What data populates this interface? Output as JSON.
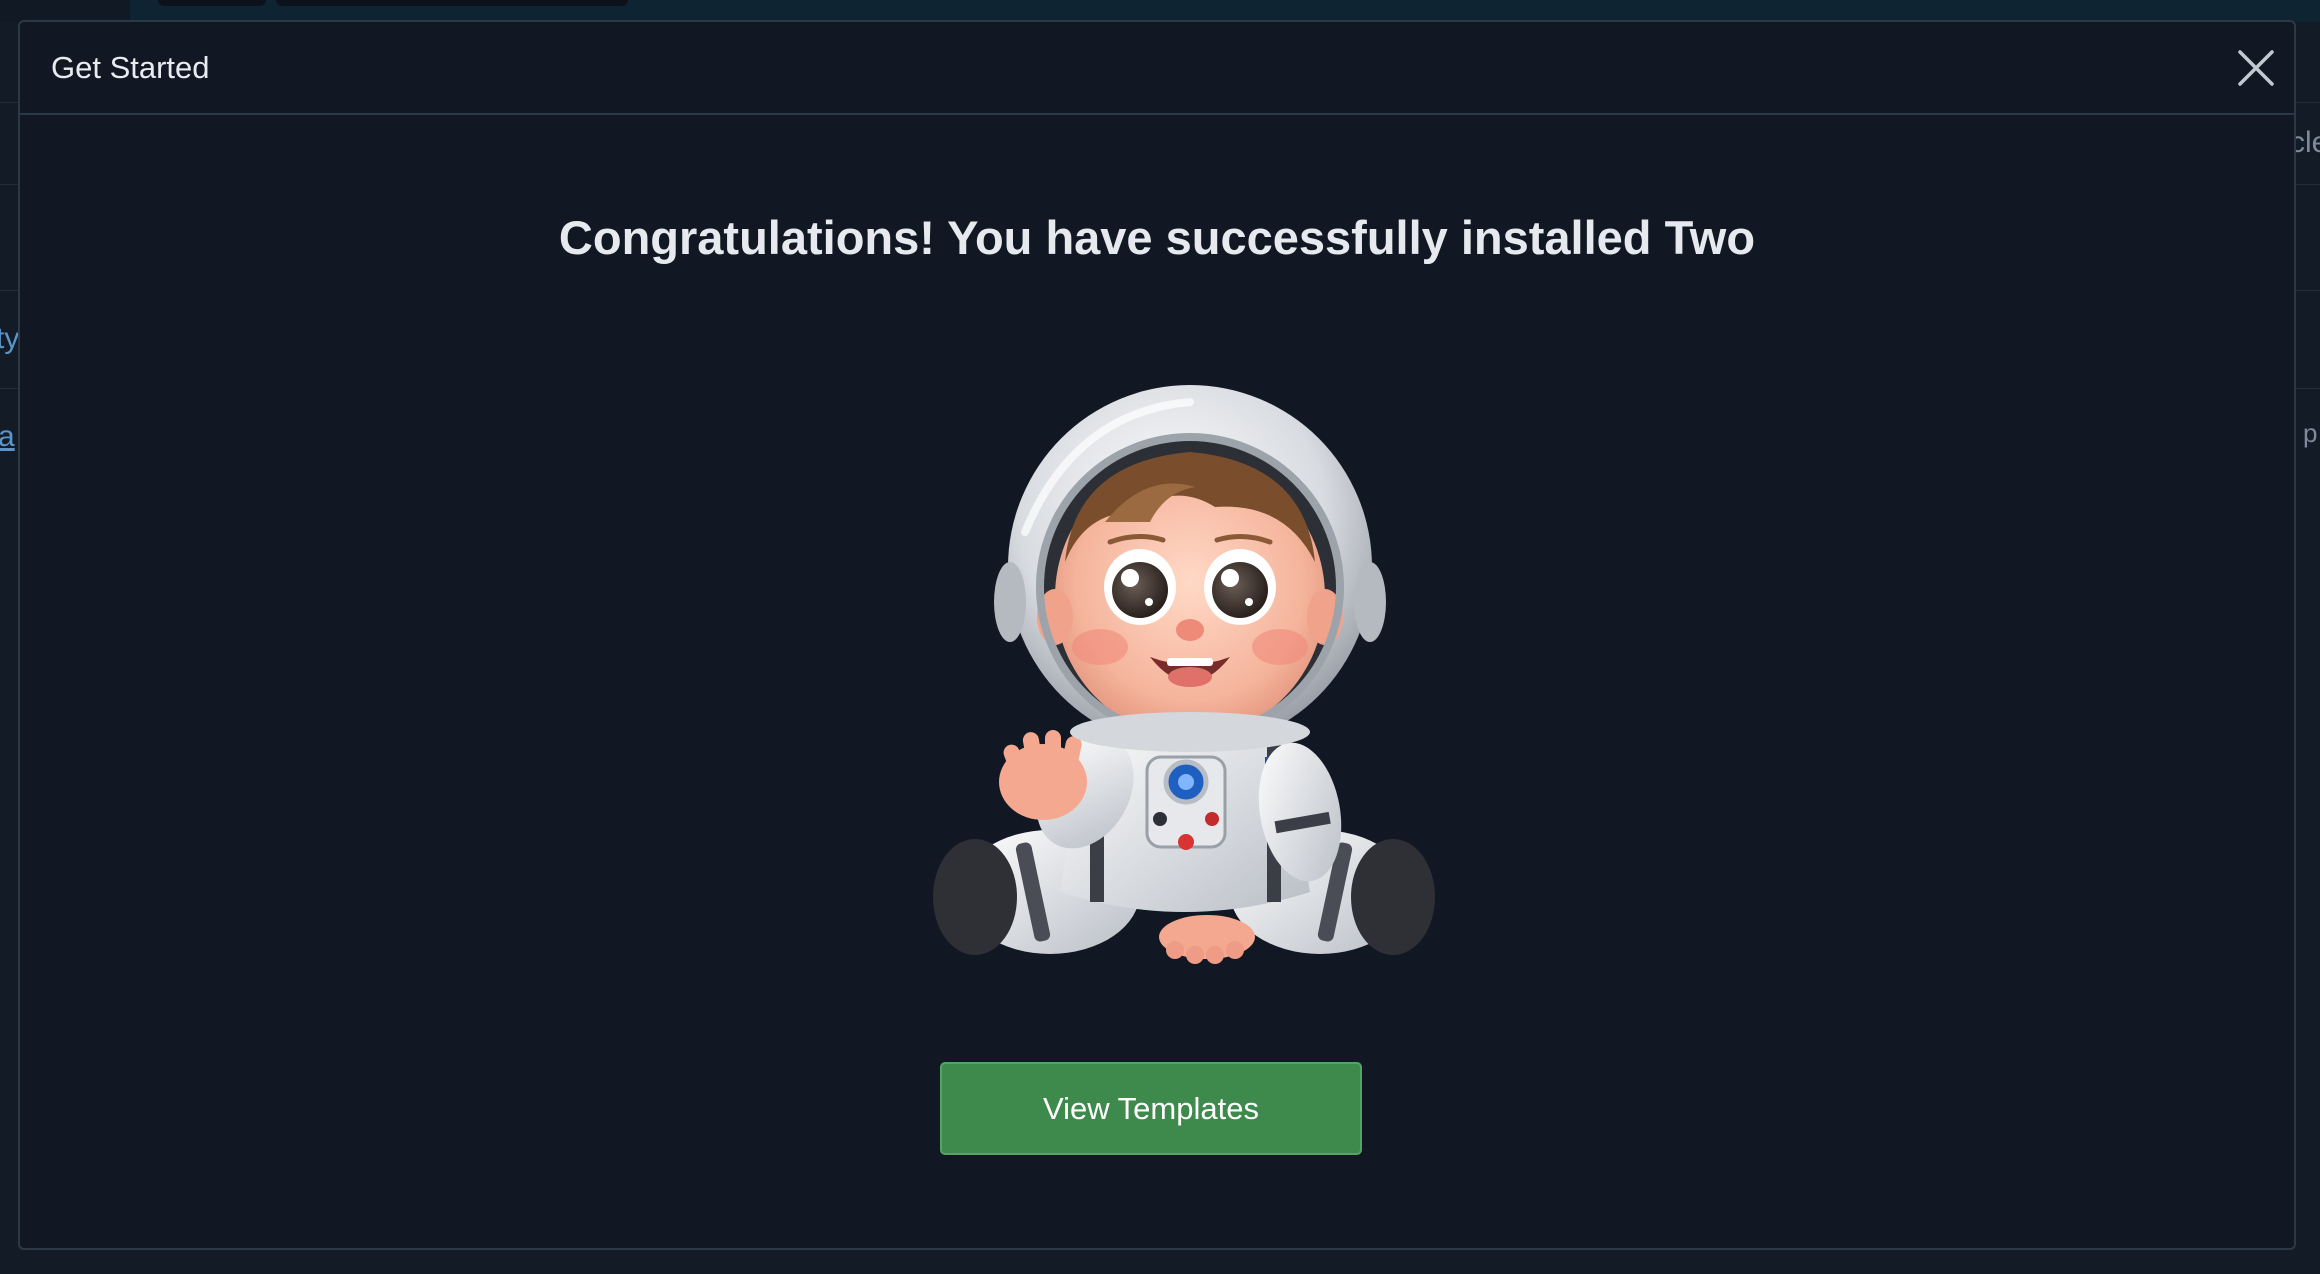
{
  "background": {
    "right_fragments": [
      "cle",
      "l p"
    ],
    "left_fragments": [
      "ty",
      "a"
    ]
  },
  "modal": {
    "title": "Get Started",
    "heading": "Congratulations! You have successfully installed Two",
    "illustration": "baby-astronaut-waving",
    "primary_button": "View Templates",
    "close_icon": "close-icon"
  },
  "colors": {
    "modal_bg": "#111824",
    "button_bg": "#3d8a4c",
    "text": "#e6e9ee"
  }
}
